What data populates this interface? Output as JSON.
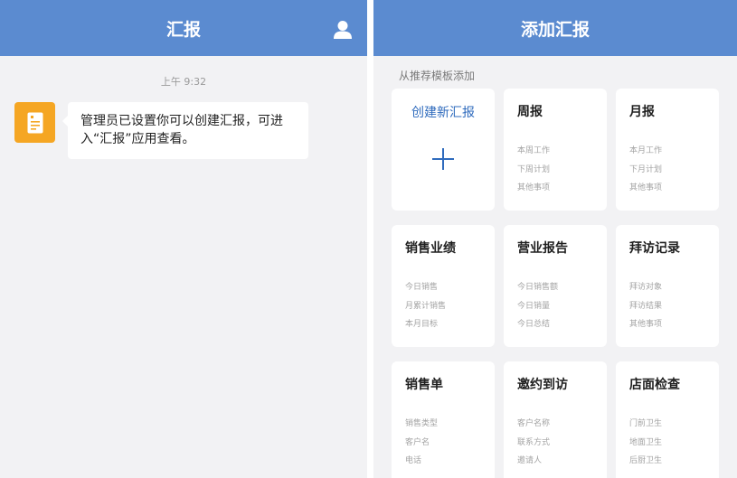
{
  "left_panel": {
    "title": "汇报",
    "timestamp": "上午 9:32",
    "message_text": "管理员已设置你可以创建汇报，可进入“汇报”应用查看。",
    "header_color": "#5b8bd0",
    "icon_color": "#f5a623",
    "icons": {
      "user": "user-icon",
      "app": "report-document-icon"
    }
  },
  "right_panel": {
    "title": "添加汇报",
    "section_label": "从推荐模板添加",
    "create_label": "创建新汇报",
    "icons": {
      "add": "plus-icon"
    },
    "cards": [
      {
        "title": "周报",
        "items": [
          "本周工作",
          "下周计划",
          "其他事项"
        ]
      },
      {
        "title": "月报",
        "items": [
          "本月工作",
          "下月计划",
          "其他事项"
        ]
      },
      {
        "title": "销售业绩",
        "items": [
          "今日销售",
          "月累计销售",
          "本月目标"
        ]
      },
      {
        "title": "营业报告",
        "items": [
          "今日销售额",
          "今日销量",
          "今日总结"
        ]
      },
      {
        "title": "拜访记录",
        "items": [
          "拜访对象",
          "拜访结果",
          "其他事项"
        ]
      },
      {
        "title": "销售单",
        "items": [
          "销售类型",
          "客户名",
          "电话"
        ]
      },
      {
        "title": "邀约到访",
        "items": [
          "客户名称",
          "联系方式",
          "邀请人"
        ]
      },
      {
        "title": "店面检查",
        "items": [
          "门前卫生",
          "地面卫生",
          "后厨卫生"
        ]
      }
    ]
  }
}
